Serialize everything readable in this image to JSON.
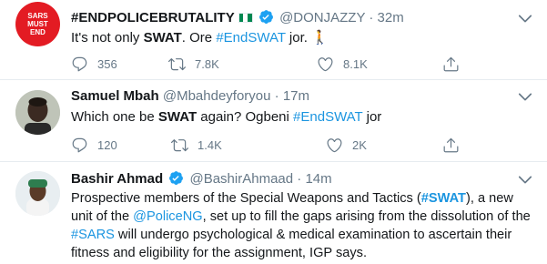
{
  "tweets": [
    {
      "name": "#ENDPOLICEBRUTALITY",
      "handle": "@DONJAZZY",
      "dot": "·",
      "time": "32m",
      "avatar_text": "SARS MUST END",
      "text_parts": [
        "It's not only ",
        "SWAT",
        ". Ore ",
        "#EndSWAT",
        " jor. ",
        "🚶"
      ],
      "replies": "356",
      "retweets": "7.8K",
      "likes": "8.1K"
    },
    {
      "name": "Samuel Mbah",
      "handle": "@Mbahdeyforyou",
      "dot": "·",
      "time": "17m",
      "text_parts": [
        "Which one be ",
        "SWAT",
        " again? Ogbeni ",
        "#EndSWAT",
        " jor"
      ],
      "replies": "120",
      "retweets": "1.4K",
      "likes": "2K"
    },
    {
      "name": "Bashir Ahmad",
      "handle": "@BashirAhmaad",
      "dot": "·",
      "time": "14m",
      "text_parts": [
        "Prospective members of the Special Weapons and Tactics (",
        "#SWAT",
        "), a new unit of the ",
        "@PoliceNG",
        ", set up to fill the gaps arising from the dissolution of the ",
        "#SARS",
        " will undergo psychological & medical examination to ascertain their fitness and eligibility for the assignment, IGP says."
      ]
    }
  ],
  "colors": {
    "accent": "#1b95e0",
    "muted": "#657786",
    "verified": "#1da1f2",
    "avatar1": "#e0245e"
  },
  "icons": [
    "reply-icon",
    "retweet-icon",
    "like-icon",
    "share-icon",
    "verified-icon",
    "chevron-down-icon",
    "nigeria-flag-icon"
  ]
}
